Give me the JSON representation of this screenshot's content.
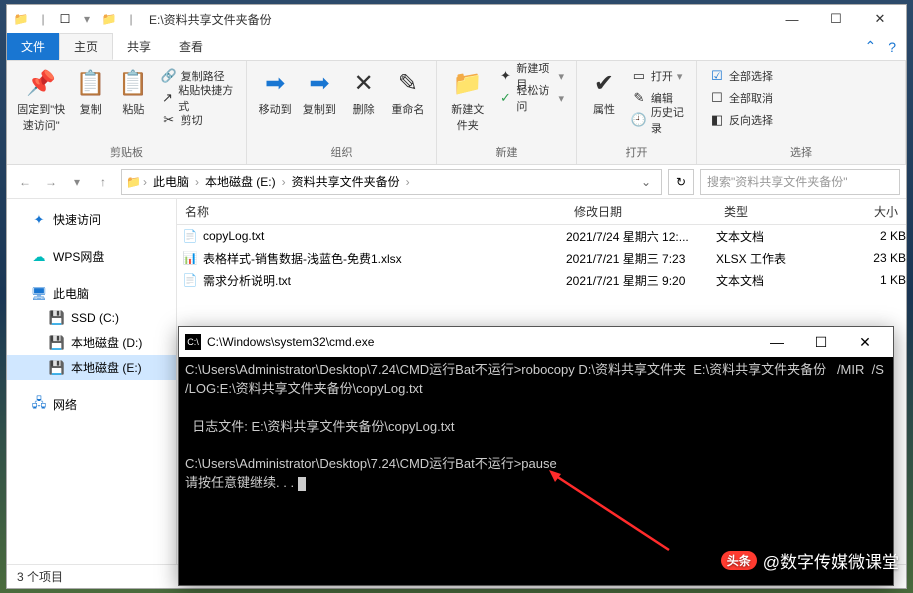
{
  "window": {
    "title": "E:\\资料共享文件夹备份",
    "min": "—",
    "max": "☐",
    "close": "✕"
  },
  "tabs": {
    "file": "文件",
    "home": "主页",
    "share": "共享",
    "view": "查看"
  },
  "ribbon": {
    "pin": "固定到\"快速访问\"",
    "copy": "复制",
    "paste": "粘贴",
    "copy_path": "复制路径",
    "paste_shortcut": "粘贴快捷方式",
    "cut": "剪切",
    "clipboard": "剪贴板",
    "move_to": "移动到",
    "copy_to": "复制到",
    "delete": "删除",
    "rename": "重命名",
    "organize": "组织",
    "new_folder": "新建文件夹",
    "new_item": "新建项目",
    "easy_access": "轻松访问",
    "new": "新建",
    "properties": "属性",
    "open": "打开",
    "edit": "编辑",
    "history": "历史记录",
    "open_grp": "打开",
    "select_all": "全部选择",
    "select_none": "全部取消",
    "invert": "反向选择",
    "select": "选择"
  },
  "address": {
    "root": "此电脑",
    "drive": "本地磁盘 (E:)",
    "folder": "资料共享文件夹备份",
    "search_placeholder": "搜索\"资料共享文件夹备份\""
  },
  "nav": {
    "quick": "快速访问",
    "wps": "WPS网盘",
    "pc": "此电脑",
    "ssd": "SSD (C:)",
    "d": "本地磁盘 (D:)",
    "e": "本地磁盘 (E:)",
    "network": "网络"
  },
  "columns": {
    "name": "名称",
    "date": "修改日期",
    "type": "类型",
    "size": "大小"
  },
  "files": [
    {
      "name": "copyLog.txt",
      "date": "2021/7/24 星期六 12:...",
      "type": "文本文档",
      "size": "2 KB",
      "icon": "📄"
    },
    {
      "name": "表格样式-销售数据-浅蓝色-免费1.xlsx",
      "date": "2021/7/21 星期三 7:23",
      "type": "XLSX 工作表",
      "size": "23 KB",
      "icon": "📊"
    },
    {
      "name": "需求分析说明.txt",
      "date": "2021/7/21 星期三 9:20",
      "type": "文本文档",
      "size": "1 KB",
      "icon": "📄"
    }
  ],
  "status": "3 个项目",
  "cmd": {
    "title": "C:\\Windows\\system32\\cmd.exe",
    "line1": "C:\\Users\\Administrator\\Desktop\\7.24\\CMD运行Bat不运行>robocopy D:\\资料共享文件夹  E:\\资料共享文件夹备份   /MIR  /S  /LOG:E:\\资料共享文件夹备份\\copyLog.txt",
    "line2": "  日志文件: E:\\资料共享文件夹备份\\copyLog.txt",
    "line3": "C:\\Users\\Administrator\\Desktop\\7.24\\CMD运行Bat不运行>pause",
    "line4": "请按任意键继续. . . "
  },
  "watermark": {
    "badge": "头条",
    "text": "@数字传媒微课堂"
  }
}
